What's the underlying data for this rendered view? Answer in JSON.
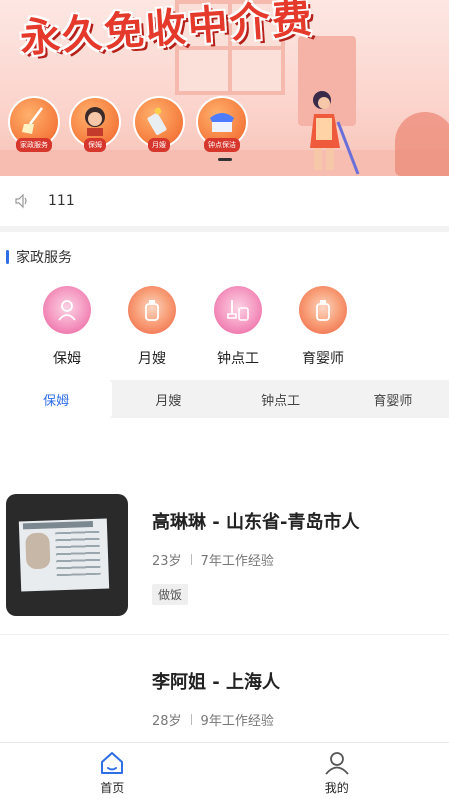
{
  "banner": {
    "title": "永久免收中介费",
    "categories": [
      {
        "label": "家政服务",
        "icon": "broom-icon"
      },
      {
        "label": "保姆",
        "icon": "nanny-icon"
      },
      {
        "label": "月嫂",
        "icon": "baby-bottle-icon"
      },
      {
        "label": "钟点保洁",
        "icon": "cleaning-icon"
      }
    ]
  },
  "notice": {
    "text": "111",
    "icon": "speaker-icon"
  },
  "section": {
    "title": "家政服务",
    "services": [
      {
        "label": "保姆",
        "icon": "nanny-icon",
        "color": "pink"
      },
      {
        "label": "月嫂",
        "icon": "bottle-icon",
        "color": "orange"
      },
      {
        "label": "钟点工",
        "icon": "mop-bucket-icon",
        "color": "pink"
      },
      {
        "label": "育婴师",
        "icon": "bottle-icon",
        "color": "orange"
      }
    ]
  },
  "tabs": [
    "保姆",
    "月嫂",
    "钟点工",
    "育婴师"
  ],
  "active_tab": "保姆",
  "workers": [
    {
      "name": "高琳琳 - 山东省-青岛市人",
      "age": "23岁",
      "experience": "7年工作经验",
      "skill": "做饭"
    },
    {
      "name": "李阿姐 - 上海人",
      "age": "28岁",
      "experience": "9年工作经验"
    }
  ],
  "bottom_nav": [
    {
      "label": "首页",
      "icon": "home-icon",
      "active": true
    },
    {
      "label": "我的",
      "icon": "user-icon",
      "active": false
    }
  ],
  "colors": {
    "accent": "#2f6ee5",
    "banner_title": "#e53a2b"
  }
}
